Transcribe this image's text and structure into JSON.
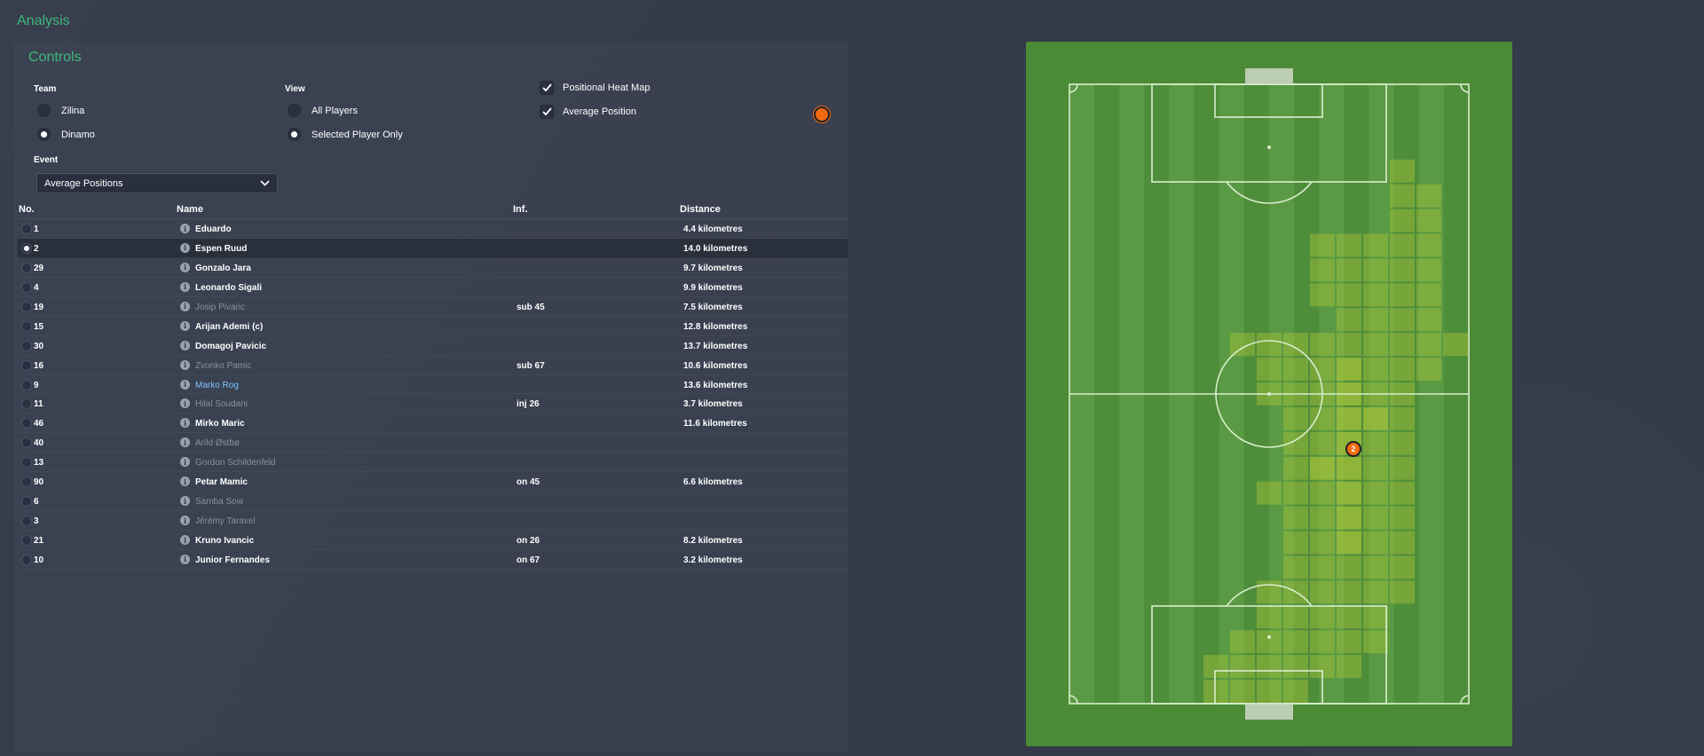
{
  "page": {
    "title": "Analysis"
  },
  "controls": {
    "title": "Controls",
    "team_label": "Team",
    "teams": [
      {
        "label": "Zilina",
        "selected": false
      },
      {
        "label": "Dinamo",
        "selected": true
      }
    ],
    "view_label": "View",
    "views": [
      {
        "label": "All Players",
        "selected": false
      },
      {
        "label": "Selected Player Only",
        "selected": true
      }
    ],
    "toggles": [
      {
        "label": "Positional Heat Map",
        "checked": true
      },
      {
        "label": "Average Position",
        "checked": true
      }
    ],
    "marker_color": "#f26a0f",
    "event_label": "Event",
    "event_value": "Average Positions"
  },
  "table": {
    "headers": {
      "no": "No.",
      "name": "Name",
      "inf": "Inf.",
      "distance": "Distance"
    },
    "rows": [
      {
        "no": "1",
        "name": "Eduardo",
        "inf": "",
        "distance": "4.4 kilometres",
        "style": "normal",
        "selected": false
      },
      {
        "no": "2",
        "name": "Espen Ruud",
        "inf": "",
        "distance": "14.0 kilometres",
        "style": "normal",
        "selected": true
      },
      {
        "no": "29",
        "name": "Gonzalo Jara",
        "inf": "",
        "distance": "9.7 kilometres",
        "style": "normal",
        "selected": false
      },
      {
        "no": "4",
        "name": "Leonardo Sigali",
        "inf": "",
        "distance": "9.9 kilometres",
        "style": "normal",
        "selected": false
      },
      {
        "no": "19",
        "name": "Josip Pivaric",
        "inf": "sub 45",
        "distance": "7.5 kilometres",
        "style": "dim",
        "selected": false
      },
      {
        "no": "15",
        "name": "Arijan Ademi (c)",
        "inf": "",
        "distance": "12.8 kilometres",
        "style": "normal",
        "selected": false
      },
      {
        "no": "30",
        "name": "Domagoj Pavicic",
        "inf": "",
        "distance": "13.7 kilometres",
        "style": "normal",
        "selected": false
      },
      {
        "no": "16",
        "name": "Zvonko Pamic",
        "inf": "sub 67",
        "distance": "10.6 kilometres",
        "style": "dim",
        "selected": false
      },
      {
        "no": "9",
        "name": "Marko Rog",
        "inf": "",
        "distance": "13.6 kilometres",
        "style": "link",
        "selected": false
      },
      {
        "no": "11",
        "name": "Hilal Soudani",
        "inf": "inj 26",
        "distance": "3.7 kilometres",
        "style": "dim",
        "selected": false
      },
      {
        "no": "46",
        "name": "Mirko Maric",
        "inf": "",
        "distance": "11.6 kilometres",
        "style": "normal",
        "selected": false
      },
      {
        "no": "40",
        "name": "Arild Østbø",
        "inf": "",
        "distance": "",
        "style": "dim",
        "selected": false
      },
      {
        "no": "13",
        "name": "Gordon Schildenfeld",
        "inf": "",
        "distance": "",
        "style": "dim",
        "selected": false
      },
      {
        "no": "90",
        "name": "Petar Mamic",
        "inf": "on 45",
        "distance": "6.6 kilometres",
        "style": "normal",
        "selected": false
      },
      {
        "no": "6",
        "name": "Samba Sow",
        "inf": "",
        "distance": "",
        "style": "dim",
        "selected": false
      },
      {
        "no": "3",
        "name": "Jérémy Taravel",
        "inf": "",
        "distance": "",
        "style": "dim",
        "selected": false
      },
      {
        "no": "21",
        "name": "Kruno Ivancic",
        "inf": "on 26",
        "distance": "8.2 kilometres",
        "style": "normal",
        "selected": false
      },
      {
        "no": "10",
        "name": "Junior Fernandes",
        "inf": "on 67",
        "distance": "3.2 kilometres",
        "style": "normal",
        "selected": false
      }
    ]
  },
  "pitch": {
    "grass_color": "#4c8b36",
    "heat_color": "#a9c43a",
    "player_marker": {
      "label": "2",
      "color": "#f26a0f"
    }
  }
}
